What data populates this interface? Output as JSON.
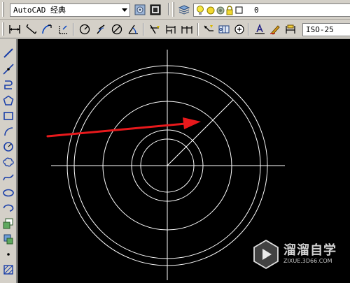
{
  "toolbar_top": {
    "workspace_dropdown": {
      "value": "AutoCAD 经典"
    },
    "layer_dropdown": {
      "value": "0"
    }
  },
  "toolbar_dim": {
    "dimstyle_dropdown": {
      "value": "ISO-25"
    }
  },
  "watermark": {
    "brand": "溜溜自学",
    "url": "ZIXUE.3D66.COM"
  },
  "colors": {
    "ui_face": "#d4d0c8",
    "canvas": "#000000",
    "geometry": "#ffffff",
    "annotation_arrow": "#e8191c"
  },
  "icons": {
    "draw_toolbar": [
      "line-icon",
      "construction-line-icon",
      "polyline-icon",
      "polygon-icon",
      "rectangle-icon",
      "arc-icon",
      "circle-icon",
      "revision-cloud-icon",
      "spline-icon",
      "ellipse-icon",
      "ellipse-arc-icon",
      "insert-block-icon",
      "make-block-icon",
      "point-icon",
      "hatch-icon"
    ]
  }
}
